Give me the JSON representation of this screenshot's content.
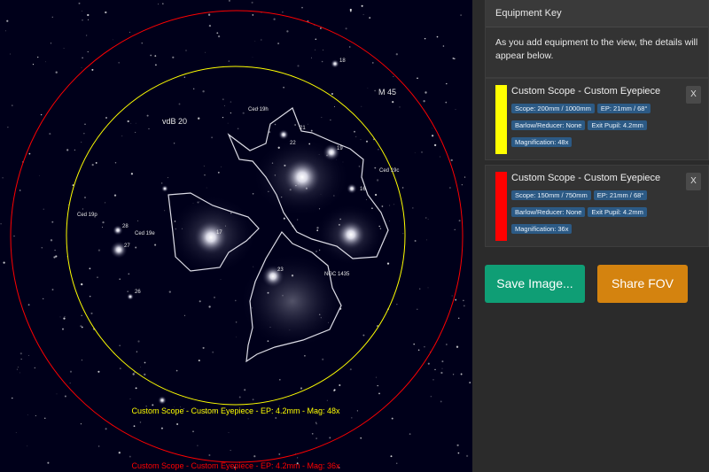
{
  "sky": {
    "object_labels": [
      "18",
      "M 45",
      "Ced 19h",
      "vdB 20",
      "21",
      "22",
      "19",
      "Ced 19c",
      "16",
      "Ced 19p",
      "28",
      "27",
      "Ced 19e",
      "17",
      "NGC 1435",
      "23",
      "26"
    ],
    "fov_labels": [
      {
        "text": "Custom Scope - Custom Eyepiece - EP: 4.2mm - Mag: 48x",
        "color": "#ffff00"
      },
      {
        "text": "Custom Scope - Custom Eyepiece - EP: 4.2mm - Mag: 36x",
        "color": "#ff0000"
      }
    ],
    "circle_colors": {
      "inner": "#ffff00",
      "outer": "#ff0000"
    }
  },
  "equipment_key": {
    "title": "Equipment Key",
    "description": "As you add equipment to the view, the details will appear below.",
    "items": [
      {
        "title": "Custom Scope - Custom Eyepiece",
        "color": "#ffff00",
        "tags": [
          "Scope: 200mm / 1000mm",
          "EP: 21mm / 68°",
          "Barlow/Reducer: None",
          "Exit Pupil: 4.2mm",
          "Magnification: 48x"
        ],
        "close_label": "X"
      },
      {
        "title": "Custom Scope - Custom Eyepiece",
        "color": "#ff0000",
        "tags": [
          "Scope: 150mm / 750mm",
          "EP: 21mm / 68°",
          "Barlow/Reducer: None",
          "Exit Pupil: 4.2mm",
          "Magnification: 36x"
        ],
        "close_label": "X"
      }
    ]
  },
  "actions": {
    "save_label": "Save Image...",
    "share_label": "Share FOV",
    "save_color": "#0f9e75",
    "share_color": "#d4830f"
  }
}
